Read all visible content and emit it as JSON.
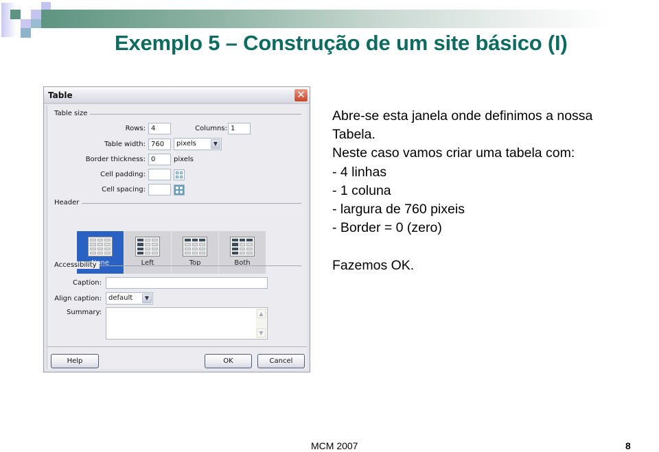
{
  "slide": {
    "title": "Exemplo 5 – Construção de um site básico (I)",
    "title_color": "#0d6b62",
    "footer_left": "MCM 2007",
    "page_number": "8"
  },
  "dialog": {
    "title": "Table",
    "close_icon": "close-icon",
    "table_size": {
      "group_label": "Table size",
      "rows_label": "Rows:",
      "rows_value": "4",
      "columns_label": "Columns:",
      "columns_value": "1",
      "table_width_label": "Table width:",
      "table_width_value": "760",
      "width_unit_selected": "pixels",
      "border_thickness_label": "Border thickness:",
      "border_thickness_value": "0",
      "border_unit": "pixels",
      "cell_padding_label": "Cell padding:",
      "cell_padding_value": "",
      "cell_spacing_label": "Cell spacing:",
      "cell_spacing_value": ""
    },
    "header": {
      "group_label": "Header",
      "options": [
        {
          "label": "None",
          "selected": true
        },
        {
          "label": "Left",
          "selected": false
        },
        {
          "label": "Top",
          "selected": false
        },
        {
          "label": "Both",
          "selected": false
        }
      ]
    },
    "accessibility": {
      "group_label": "Accessibility",
      "caption_label": "Caption:",
      "caption_value": "",
      "align_caption_label": "Align caption:",
      "align_caption_selected": "default",
      "summary_label": "Summary:",
      "summary_value": ""
    },
    "buttons": {
      "help": "Help",
      "ok": "OK",
      "cancel": "Cancel"
    }
  },
  "description": {
    "lines": [
      "Abre-se esta janela onde definimos a nossa",
      "Tabela.",
      "Neste caso vamos criar uma tabela com:",
      "- 4 linhas",
      "- 1 coluna",
      "- largura de 760 pixeis",
      "- Border = 0 (zero)",
      "",
      "Fazemos OK."
    ]
  }
}
